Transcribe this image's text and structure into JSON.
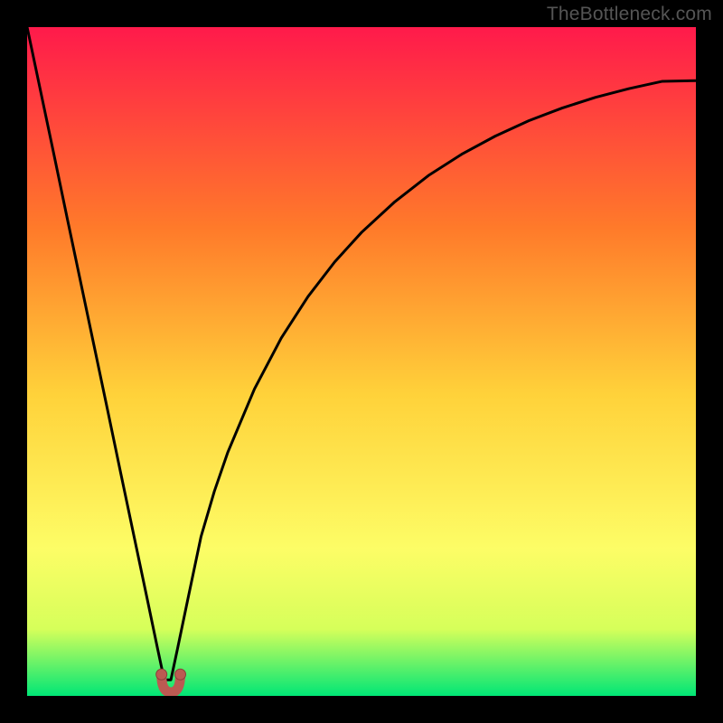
{
  "watermark": "TheBottleneck.com",
  "colors": {
    "frame": "#000000",
    "gradient_top": "#ff1a4b",
    "gradient_mid1": "#ff7a2a",
    "gradient_mid2": "#ffd23a",
    "gradient_mid3": "#fdfd66",
    "gradient_mid4": "#d6ff5a",
    "gradient_bottom": "#00e676",
    "curve": "#000000",
    "marker_fill": "#bb5a52",
    "marker_stroke": "#8a3f3a"
  },
  "chart_data": {
    "type": "line",
    "title": "",
    "xlabel": "",
    "ylabel": "",
    "xlim": [
      0,
      1
    ],
    "ylim": [
      0,
      1
    ],
    "series": [
      {
        "name": "bottleneck-curve",
        "note": "Curve descending from top-left to a minimum near x≈0.21 then rising toward ~y≈0.92 at x=1. Values are bottleneck fraction (1=worst red, 0=best green).",
        "x": [
          0.0,
          0.02,
          0.04,
          0.06,
          0.08,
          0.1,
          0.12,
          0.14,
          0.16,
          0.18,
          0.195,
          0.205,
          0.215,
          0.225,
          0.24,
          0.26,
          0.28,
          0.3,
          0.34,
          0.38,
          0.42,
          0.46,
          0.5,
          0.55,
          0.6,
          0.65,
          0.7,
          0.75,
          0.8,
          0.85,
          0.9,
          0.95,
          1.0
        ],
        "y": [
          1.0,
          0.905,
          0.81,
          0.714,
          0.619,
          0.524,
          0.429,
          0.333,
          0.238,
          0.143,
          0.071,
          0.024,
          0.024,
          0.071,
          0.143,
          0.238,
          0.306,
          0.364,
          0.459,
          0.535,
          0.597,
          0.649,
          0.693,
          0.739,
          0.778,
          0.81,
          0.837,
          0.86,
          0.879,
          0.895,
          0.908,
          0.919,
          0.92
        ]
      }
    ],
    "markers": [
      {
        "name": "min-marker-left",
        "x": 0.205,
        "y": 0.024
      },
      {
        "name": "min-marker-right",
        "x": 0.225,
        "y": 0.024
      }
    ]
  }
}
